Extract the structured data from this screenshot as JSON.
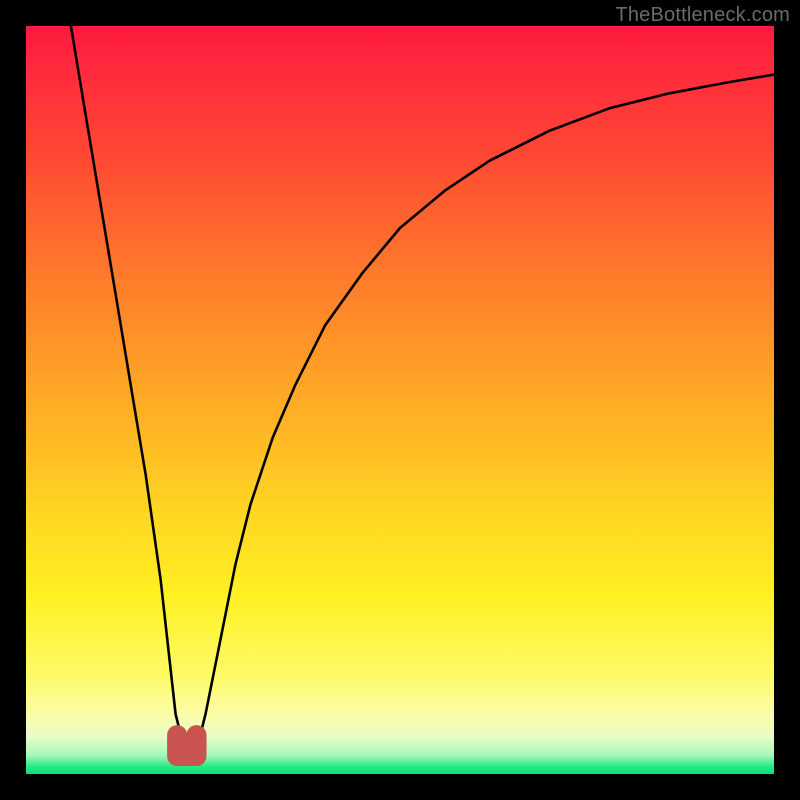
{
  "watermark": "TheBottleneck.com",
  "chart_data": {
    "type": "line",
    "title": "",
    "xlabel": "",
    "ylabel": "",
    "xlim": [
      0,
      100
    ],
    "ylim": [
      0,
      100
    ],
    "grid": false,
    "series": [
      {
        "name": "bottleneck-curve",
        "x": [
          6,
          8,
          10,
          12,
          14,
          16,
          18,
          19,
          20,
          21,
          22,
          23,
          24,
          26,
          28,
          30,
          33,
          36,
          40,
          45,
          50,
          56,
          62,
          70,
          78,
          86,
          94,
          100
        ],
        "y": [
          100,
          88,
          76,
          64,
          52,
          40,
          26,
          17,
          8,
          4,
          3,
          4,
          8,
          18,
          28,
          36,
          45,
          52,
          60,
          67,
          73,
          78,
          82,
          86,
          89,
          91,
          92.5,
          93.5
        ]
      }
    ],
    "marker": {
      "name": "optimal-point",
      "x_range": [
        20.2,
        22.8
      ],
      "y": 3,
      "color": "#c9544f"
    },
    "colors": {
      "curve": "#000000",
      "top": "#ff1a3f",
      "mid": "#ffd323",
      "bottom": "#00e472",
      "marker": "#c9544f",
      "frame": "#000000"
    }
  }
}
